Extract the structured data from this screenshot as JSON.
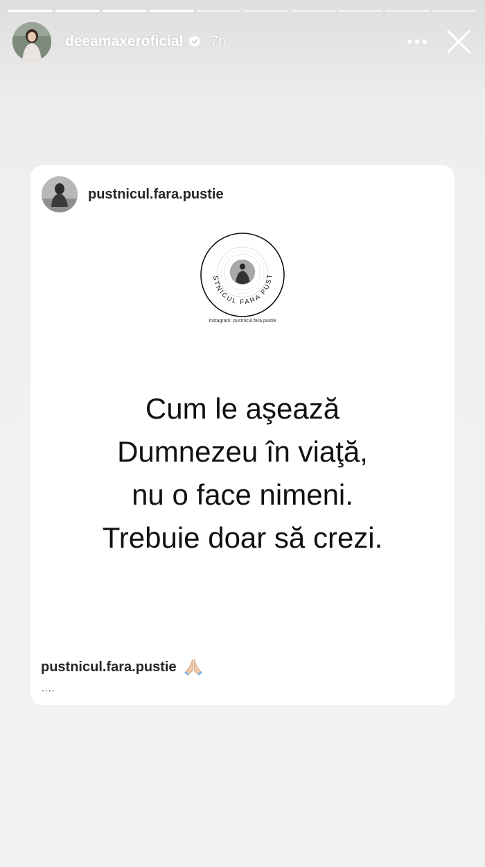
{
  "progress": {
    "total": 10,
    "completed": 4
  },
  "header": {
    "username": "deeamaxeroficial",
    "time": "7h",
    "verified": true
  },
  "shared_post": {
    "account": "pustnicul.fara.pustie",
    "logo": {
      "ring_text": "PUSTNICUL FARA PUSTIE",
      "caption": "Instagram: pustnicul.fara.pustie"
    },
    "quote_lines": [
      "Cum le aşează",
      "Dumnezeu în viaţă,",
      "nu o face nimeni.",
      "Trebuie doar să crezi."
    ],
    "caption_user": "pustnicul.fara.pustie",
    "caption_emoji": "pray-hands-icon",
    "caption_more": "...."
  },
  "colors": {
    "verified_badge": "#ffffff",
    "card_bg": "#ffffff",
    "text": "#111111"
  }
}
